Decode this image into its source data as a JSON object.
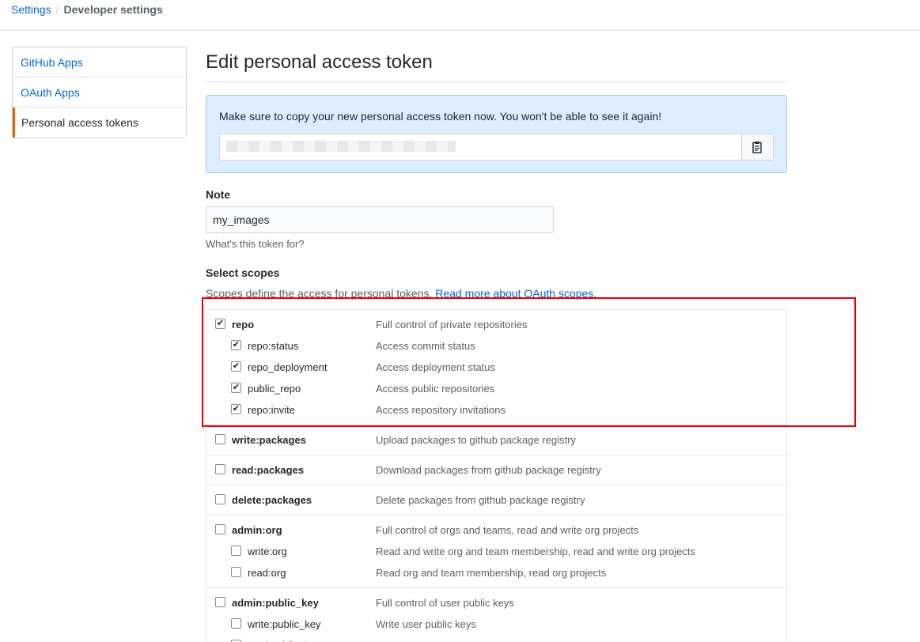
{
  "breadcrumb": {
    "root": "Settings",
    "separator": "/",
    "current": "Developer settings"
  },
  "sidebar": {
    "items": [
      {
        "label": "GitHub Apps"
      },
      {
        "label": "OAuth Apps"
      },
      {
        "label": "Personal access tokens"
      }
    ]
  },
  "main": {
    "title": "Edit personal access token",
    "flash": {
      "message": "Make sure to copy your new personal access token now. You won't be able to see it again!",
      "token": "••••••••••••••••••••••••••••••••••••••••"
    },
    "note": {
      "label": "Note",
      "value": "my_images",
      "hint": "What's this token for?"
    },
    "scopes": {
      "label": "Select scopes",
      "description": "Scopes define the access for personal tokens.",
      "link": "Read more about OAuth scopes."
    }
  },
  "scope_groups": [
    {
      "name": "repo",
      "desc": "Full control of private repositories",
      "checked": true,
      "children": [
        {
          "name": "repo:status",
          "desc": "Access commit status",
          "checked": true
        },
        {
          "name": "repo_deployment",
          "desc": "Access deployment status",
          "checked": true
        },
        {
          "name": "public_repo",
          "desc": "Access public repositories",
          "checked": true
        },
        {
          "name": "repo:invite",
          "desc": "Access repository invitations",
          "checked": true
        }
      ]
    },
    {
      "name": "write:packages",
      "desc": "Upload packages to github package registry",
      "checked": false,
      "children": []
    },
    {
      "name": "read:packages",
      "desc": "Download packages from github package registry",
      "checked": false,
      "children": []
    },
    {
      "name": "delete:packages",
      "desc": "Delete packages from github package registry",
      "checked": false,
      "children": []
    },
    {
      "name": "admin:org",
      "desc": "Full control of orgs and teams, read and write org projects",
      "checked": false,
      "children": [
        {
          "name": "write:org",
          "desc": "Read and write org and team membership, read and write org projects",
          "checked": false
        },
        {
          "name": "read:org",
          "desc": "Read org and team membership, read org projects",
          "checked": false
        }
      ]
    },
    {
      "name": "admin:public_key",
      "desc": "Full control of user public keys",
      "checked": false,
      "children": [
        {
          "name": "write:public_key",
          "desc": "Write user public keys",
          "checked": false
        },
        {
          "name": "read:public_key",
          "desc": "",
          "checked": false
        }
      ]
    }
  ],
  "colors": {
    "link": "#0366d6",
    "selected_accent": "#e36209",
    "flash_bg": "#dbedff",
    "highlight": "#ee0000"
  },
  "icons": {
    "copy": "clippy-icon",
    "check": "checkmark-icon"
  }
}
